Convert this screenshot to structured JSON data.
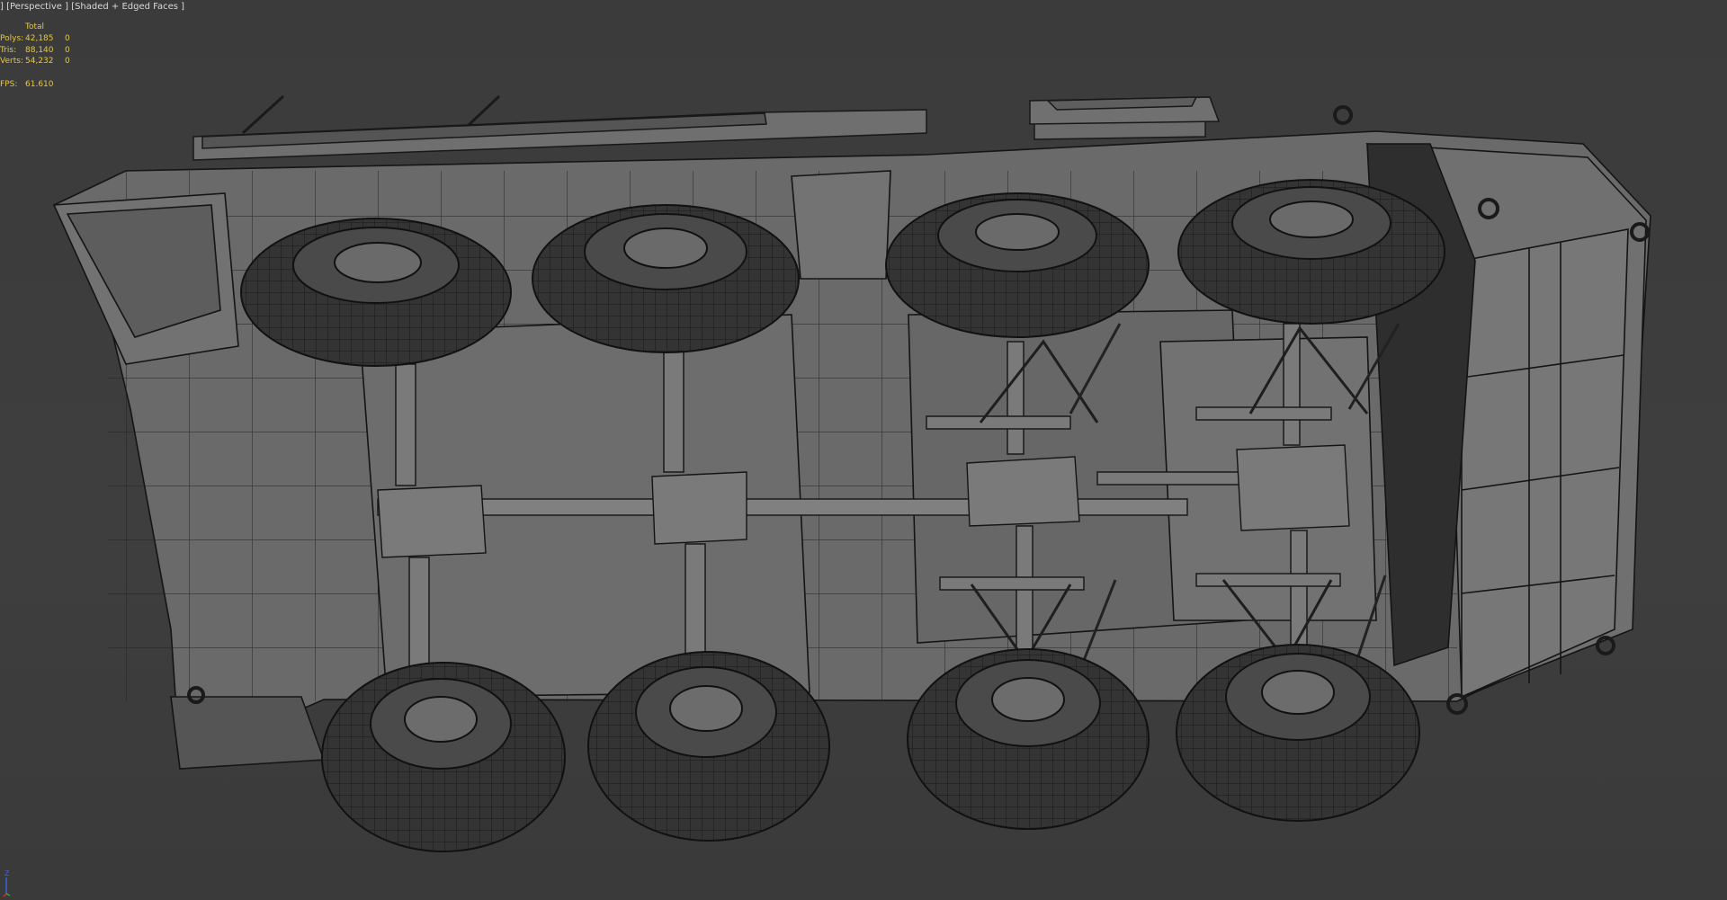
{
  "viewport": {
    "label_prefix": "]",
    "view_name": "[Perspective ]",
    "shading_mode": "[Shaded + Edged Faces ]"
  },
  "stats": {
    "header": "Total",
    "rows": [
      {
        "label": "Polys:",
        "total": "42,185",
        "selected": "0"
      },
      {
        "label": "Tris:",
        "total": "88,140",
        "selected": "0"
      },
      {
        "label": "Verts:",
        "total": "54,232",
        "selected": "0"
      }
    ],
    "fps_label": "FPS:",
    "fps_value": "61.610"
  },
  "axis_gizmo": {
    "label": "Z",
    "x_color": "#d03030",
    "y_color": "#30b030",
    "z_color": "#4060e0"
  },
  "colors": {
    "background": "#3c3c3c",
    "stats_text": "#e8c840",
    "label_text": "#d8d8d8",
    "mesh_fill": "#6a6a6a",
    "tire_fill": "#323232",
    "wire": "#141414"
  }
}
